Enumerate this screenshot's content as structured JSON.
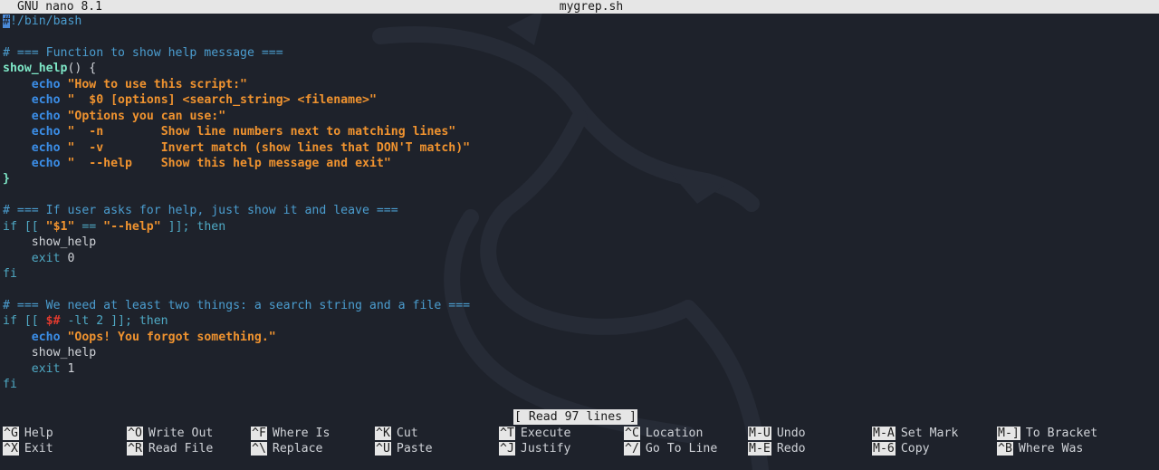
{
  "titlebar": {
    "app": "GNU nano 8.1",
    "filename": "mygrep.sh"
  },
  "code_lines": [
    [
      {
        "c": "cursor",
        "t": "#"
      },
      {
        "c": "c-com",
        "t": "!/bin/bash"
      }
    ],
    [],
    [
      {
        "c": "c-com",
        "t": "# === Function to show help message ==="
      }
    ],
    [
      {
        "c": "c-fn",
        "t": "show_help"
      },
      {
        "c": "c-plain",
        "t": "() {"
      }
    ],
    [
      {
        "c": "c-plain",
        "t": "    "
      },
      {
        "c": "c-kw",
        "t": "echo"
      },
      {
        "c": "c-plain",
        "t": " "
      },
      {
        "c": "c-str",
        "t": "\"How to use this script:\""
      }
    ],
    [
      {
        "c": "c-plain",
        "t": "    "
      },
      {
        "c": "c-kw",
        "t": "echo"
      },
      {
        "c": "c-plain",
        "t": " "
      },
      {
        "c": "c-str",
        "t": "\"  $0 [options] <search_string> <filename>\""
      }
    ],
    [
      {
        "c": "c-plain",
        "t": "    "
      },
      {
        "c": "c-kw",
        "t": "echo"
      },
      {
        "c": "c-plain",
        "t": " "
      },
      {
        "c": "c-str",
        "t": "\"Options you can use:\""
      }
    ],
    [
      {
        "c": "c-plain",
        "t": "    "
      },
      {
        "c": "c-kw",
        "t": "echo"
      },
      {
        "c": "c-plain",
        "t": " "
      },
      {
        "c": "c-str",
        "t": "\"  -n        Show line numbers next to matching lines\""
      }
    ],
    [
      {
        "c": "c-plain",
        "t": "    "
      },
      {
        "c": "c-kw",
        "t": "echo"
      },
      {
        "c": "c-plain",
        "t": " "
      },
      {
        "c": "c-str",
        "t": "\"  -v        Invert match (show lines that DON'T match)\""
      }
    ],
    [
      {
        "c": "c-plain",
        "t": "    "
      },
      {
        "c": "c-kw",
        "t": "echo"
      },
      {
        "c": "c-plain",
        "t": " "
      },
      {
        "c": "c-str",
        "t": "\"  --help    Show this help message and exit\""
      }
    ],
    [
      {
        "c": "c-fn",
        "t": "}"
      }
    ],
    [],
    [
      {
        "c": "c-com",
        "t": "# === If user asks for help, just show it and leave ==="
      }
    ],
    [
      {
        "c": "c-ctl",
        "t": "if [[ "
      },
      {
        "c": "c-str",
        "t": "\"$1\""
      },
      {
        "c": "c-ctl",
        "t": " == "
      },
      {
        "c": "c-str",
        "t": "\"--help\""
      },
      {
        "c": "c-ctl",
        "t": " ]]; then"
      }
    ],
    [
      {
        "c": "c-plain",
        "t": "    show_help"
      }
    ],
    [
      {
        "c": "c-plain",
        "t": "    "
      },
      {
        "c": "c-ctl",
        "t": "exit"
      },
      {
        "c": "c-plain",
        "t": " 0"
      }
    ],
    [
      {
        "c": "c-ctl",
        "t": "fi"
      }
    ],
    [],
    [
      {
        "c": "c-com",
        "t": "# === We need at least two things: a search string and a file ==="
      }
    ],
    [
      {
        "c": "c-ctl",
        "t": "if [[ "
      },
      {
        "c": "c-var",
        "t": "$#"
      },
      {
        "c": "c-ctl",
        "t": " -lt 2 ]]; then"
      }
    ],
    [
      {
        "c": "c-plain",
        "t": "    "
      },
      {
        "c": "c-kw",
        "t": "echo"
      },
      {
        "c": "c-plain",
        "t": " "
      },
      {
        "c": "c-str",
        "t": "\"Oops! You forgot something.\""
      }
    ],
    [
      {
        "c": "c-plain",
        "t": "    show_help"
      }
    ],
    [
      {
        "c": "c-plain",
        "t": "    "
      },
      {
        "c": "c-ctl",
        "t": "exit"
      },
      {
        "c": "c-plain",
        "t": " 1"
      }
    ],
    [
      {
        "c": "c-ctl",
        "t": "fi"
      }
    ]
  ],
  "status_message": "[ Read 97 lines ]",
  "shortcuts_row1": [
    {
      "key": "^G",
      "label": "Help"
    },
    {
      "key": "^O",
      "label": "Write Out"
    },
    {
      "key": "^F",
      "label": "Where Is"
    },
    {
      "key": "^K",
      "label": "Cut"
    },
    {
      "key": "^T",
      "label": "Execute"
    },
    {
      "key": "^C",
      "label": "Location"
    },
    {
      "key": "M-U",
      "label": "Undo"
    },
    {
      "key": "M-A",
      "label": "Set Mark"
    },
    {
      "key": "M-]",
      "label": "To Bracket"
    }
  ],
  "shortcuts_row2": [
    {
      "key": "^X",
      "label": "Exit"
    },
    {
      "key": "^R",
      "label": "Read File"
    },
    {
      "key": "^\\",
      "label": "Replace"
    },
    {
      "key": "^U",
      "label": "Paste"
    },
    {
      "key": "^J",
      "label": "Justify"
    },
    {
      "key": "^/",
      "label": "Go To Line"
    },
    {
      "key": "M-E",
      "label": "Redo"
    },
    {
      "key": "M-6",
      "label": "Copy"
    },
    {
      "key": "^B",
      "label": "Where Was"
    }
  ],
  "colors": {
    "background": "#1e222b",
    "comment": "#4b9dcf",
    "string": "#f0932f",
    "keyword": "#3b8ee8",
    "function": "#7ee7c7",
    "variable": "#e23a2e"
  },
  "icons": [
    "kali-dragon-wallpaper"
  ]
}
